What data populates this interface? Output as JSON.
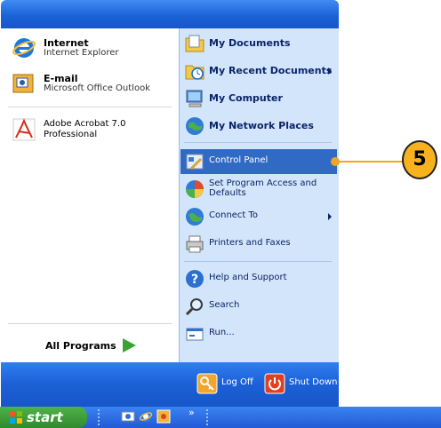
{
  "left": {
    "pinned": [
      {
        "title": "Internet",
        "subtitle": "Internet Explorer",
        "icon": "internet-explorer-icon"
      },
      {
        "title": "E-mail",
        "subtitle": "Microsoft Office Outlook",
        "icon": "outlook-icon"
      }
    ],
    "recent": [
      {
        "line1": "Adobe Acrobat 7.0",
        "line2": "Professional",
        "icon": "adobe-acrobat-icon"
      }
    ],
    "all_programs": "All Programs"
  },
  "right": {
    "items": [
      {
        "label": "My Documents",
        "icon": "my-documents-icon"
      },
      {
        "label": "My Recent Documents",
        "icon": "my-recent-documents-icon"
      },
      {
        "label": "My Computer",
        "icon": "my-computer-icon"
      },
      {
        "label": "My Network Places",
        "icon": "my-network-places-icon"
      },
      {
        "label": "Control Panel",
        "icon": "control-panel-icon"
      },
      {
        "line1": "Set Program Access and",
        "line2": "Defaults",
        "icon": "program-access-icon"
      },
      {
        "label": "Connect To",
        "icon": "connect-to-icon"
      },
      {
        "label": "Printers and Faxes",
        "icon": "printers-faxes-icon"
      },
      {
        "label": "Help and Support",
        "icon": "help-icon"
      },
      {
        "label": "Search",
        "icon": "search-icon"
      },
      {
        "label": "Run...",
        "icon": "run-icon"
      }
    ]
  },
  "bottom": {
    "log_off": "Log Off",
    "shut_down": "Shut Down"
  },
  "taskbar": {
    "start": "start",
    "chevron": "»"
  },
  "callout": {
    "number": "5"
  },
  "colors": {
    "accent": "#1c63d8",
    "highlight": "#316ac5",
    "right_pane": "#d3e5fa",
    "callout": "#f7b21e"
  }
}
